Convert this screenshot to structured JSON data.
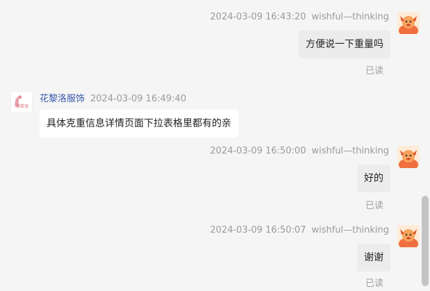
{
  "messages": [
    {
      "direction": "out",
      "time": "2024-03-09 16:43:20",
      "sender": "wishful—thinking",
      "text": "方便说一下重量吗",
      "status": "已读"
    },
    {
      "direction": "in",
      "time": "2024-03-09 16:49:40",
      "sender": "花黎洛服饰",
      "text": "具体克重信息详情页面下拉表格里都有的亲",
      "avatar_text": "花黎洛"
    },
    {
      "direction": "out",
      "time": "2024-03-09 16:50:00",
      "sender": "wishful—thinking",
      "text": "好的",
      "status": "已读"
    },
    {
      "direction": "out",
      "time": "2024-03-09 16:50:07",
      "sender": "wishful—thinking",
      "text": "谢谢",
      "status": "已读"
    }
  ],
  "colors": {
    "background": "#f5f5f5",
    "outgoing_bubble": "#ececec",
    "incoming_bubble": "#ffffff",
    "sender_name": "#3656a8",
    "avatar_self": "#f07a4a"
  },
  "icons": {
    "self_avatar": "cartoon-character-icon",
    "shop_avatar": "shop-logo"
  }
}
